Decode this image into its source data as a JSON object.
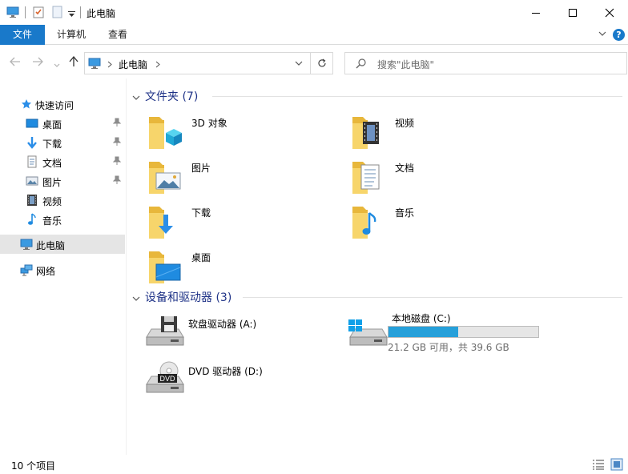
{
  "window": {
    "title": "此电脑"
  },
  "ribbon": {
    "tabs": [
      "文件",
      "计算机",
      "查看"
    ],
    "help": "?"
  },
  "address": {
    "crumb": "此电脑"
  },
  "search": {
    "placeholder": "搜索\"此电脑\""
  },
  "sidebar": {
    "quick_access": "快速访问",
    "quick_items": [
      "桌面",
      "下载",
      "文档",
      "图片",
      "视频",
      "音乐"
    ],
    "this_pc": "此电脑",
    "network": "网络"
  },
  "folders": {
    "title": "文件夹 (7)",
    "items": [
      "3D 对象",
      "视频",
      "图片",
      "文档",
      "下载",
      "音乐",
      "桌面"
    ]
  },
  "devices": {
    "title": "设备和驱动器 (3)",
    "floppy": "软盘驱动器 (A:)",
    "dvd": "DVD 驱动器 (D:)",
    "dvd_badge": "DVD",
    "local": {
      "name": "本地磁盘 (C:)",
      "free_text": "21.2 GB 可用，共 39.6 GB",
      "used_fraction": 0.465
    }
  },
  "status": {
    "count": "10 个项目"
  },
  "colors": {
    "accent": "#1979ca",
    "group_title": "#1e3287",
    "bar": "#26a0da",
    "selected": "#e5e5e5"
  }
}
